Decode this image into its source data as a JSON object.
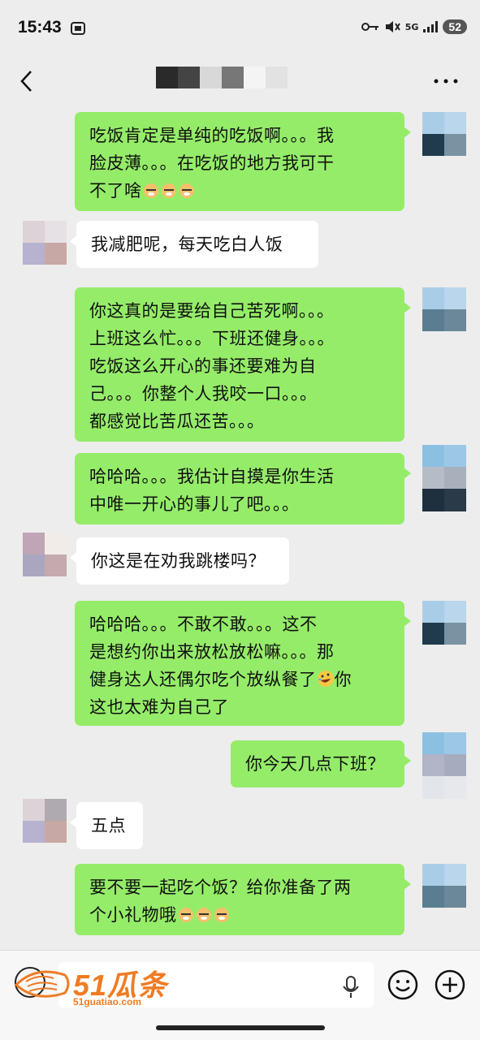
{
  "status_bar": {
    "time": "15:43",
    "network": "5G",
    "battery": "52"
  },
  "header": {
    "back_icon": "chevron-left-icon",
    "more_icon": "ellipsis-icon"
  },
  "messages": [
    {
      "side": "right",
      "text": "吃饭肯定是单纯的吃饭啊。。。我脸皮薄。。。在吃饭的地方我可干不了啥",
      "emoji": "dog-face-emoji",
      "emoji_count": 3
    },
    {
      "side": "left",
      "text": "我减肥呢，每天吃白人饭"
    },
    {
      "side": "right",
      "text": "你这真的是要给自己苦死啊。。。上班这么忙。。。下班还健身。。。吃饭这么开心的事还要难为自己。。。你整个人我咬一口。。。都感觉比苦瓜还苦。。。"
    },
    {
      "side": "right",
      "text": "哈哈哈。。。我估计自摸是你生活中唯一开心的事儿了吧。。。"
    },
    {
      "side": "left",
      "text": "你这是在劝我跳楼吗？"
    },
    {
      "side": "right",
      "text": "哈哈哈。。。不敢不敢。。。这不是想约你出来放松放松嘛。。。那健身达人还偶尔吃个放纵餐了",
      "text_after_emoji": "你这也太难为自己了",
      "emoji": "rolling-laughing-emoji"
    },
    {
      "side": "right",
      "text": "你今天几点下班？"
    },
    {
      "side": "left",
      "text": "五点"
    },
    {
      "side": "right",
      "text": "要不要一起吃个饭？给你准备了两个小礼物哦",
      "emoji": "dog-face-emoji",
      "emoji_count": 3
    }
  ],
  "bubble_lines": {
    "m0": [
      "吃饭肯定是单纯的吃饭啊。。。我",
      "脸皮薄。。。在吃饭的地方我可干",
      "不了啥"
    ],
    "m2": [
      "你这真的是要给自己苦死啊。。。",
      "上班这么忙。。。下班还健身。。。",
      "吃饭这么开心的事还要难为自",
      "己。。。你整个人我咬一口。。。",
      "都感觉比苦瓜还苦。。。"
    ],
    "m3": [
      "哈哈哈。。。我估计自摸是你生活",
      "中唯一开心的事儿了吧。。。"
    ],
    "m5": [
      "哈哈哈。。。不敢不敢。。。这不",
      "是想约你出来放松放松嘛。。。那",
      "健身达人还偶尔吃个放纵餐了",
      "你",
      "这也太难为自己了"
    ],
    "m8": [
      "要不要一起吃个饭？给你准备了两",
      "个小礼物哦"
    ]
  },
  "input_bar": {
    "voice_icon": "voice-icon",
    "mic_icon": "mic-icon",
    "emoji_icon": "emoji-face-icon",
    "plus_icon": "plus-icon"
  },
  "watermark": {
    "big": "51瓜条",
    "small": "51guatiao.com"
  },
  "colors": {
    "right_bubble": "#95ec69",
    "left_bubble": "#ffffff",
    "background": "#ededed",
    "watermark": "#f07b22"
  }
}
